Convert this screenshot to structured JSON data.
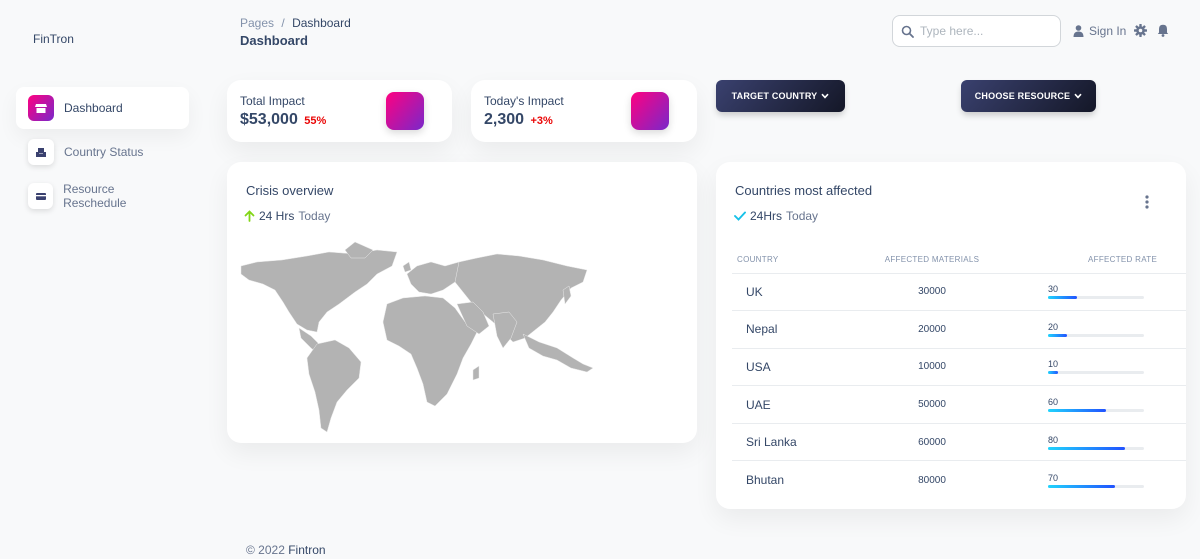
{
  "brand": "FinTron",
  "sidebar": {
    "items": [
      {
        "label": "Dashboard",
        "icon": "shop-icon"
      },
      {
        "label": "Country Status",
        "icon": "office-icon"
      },
      {
        "label": "Resource Reschedule",
        "icon": "credit-card-icon"
      }
    ]
  },
  "header": {
    "breadcrumb_root": "Pages",
    "breadcrumb_sep": "/",
    "breadcrumb_current": "Dashboard",
    "title": "Dashboard",
    "search_placeholder": "Type here...",
    "signin_label": "Sign In"
  },
  "stats": [
    {
      "label": "Total Impact",
      "value": "$53,000",
      "change": "55%"
    },
    {
      "label": "Today's Impact",
      "value": "2,300",
      "change": "+3%"
    }
  ],
  "buttons": {
    "target_country": "TARGET COUNTRY",
    "choose_resource": "CHOOSE RESOURCE"
  },
  "crisis": {
    "title": "Crisis overview",
    "sub_bold": "24 Hrs",
    "sub_rest": "Today"
  },
  "affected": {
    "title": "Countries most affected",
    "sub_bold": "24Hrs",
    "sub_rest": "Today",
    "columns": [
      "COUNTRY",
      "AFFECTED MATERIALS",
      "AFFECTED RATE"
    ],
    "rows": [
      {
        "country": "UK",
        "materials": "30000",
        "rate": "30",
        "rate_pct": 30
      },
      {
        "country": "Nepal",
        "materials": "20000",
        "rate": "20",
        "rate_pct": 20
      },
      {
        "country": "USA",
        "materials": "10000",
        "rate": "10",
        "rate_pct": 10
      },
      {
        "country": "UAE",
        "materials": "50000",
        "rate": "60",
        "rate_pct": 60
      },
      {
        "country": "Sri Lanka",
        "materials": "60000",
        "rate": "80",
        "rate_pct": 80
      },
      {
        "country": "Bhutan",
        "materials": "80000",
        "rate": "70",
        "rate_pct": 70
      }
    ]
  },
  "footer": {
    "prefix": "© 2022",
    "name": "Fintron"
  },
  "colors": {
    "accent_gradient_start": "#7928ca",
    "accent_gradient_end": "#ff0080",
    "negative": "#ea0606",
    "bar_start": "#21d4fd",
    "bar_end": "#2152ff",
    "up_arrow": "#82d616",
    "check": "#17c1e8",
    "map_fill": "#b3b3b3"
  }
}
